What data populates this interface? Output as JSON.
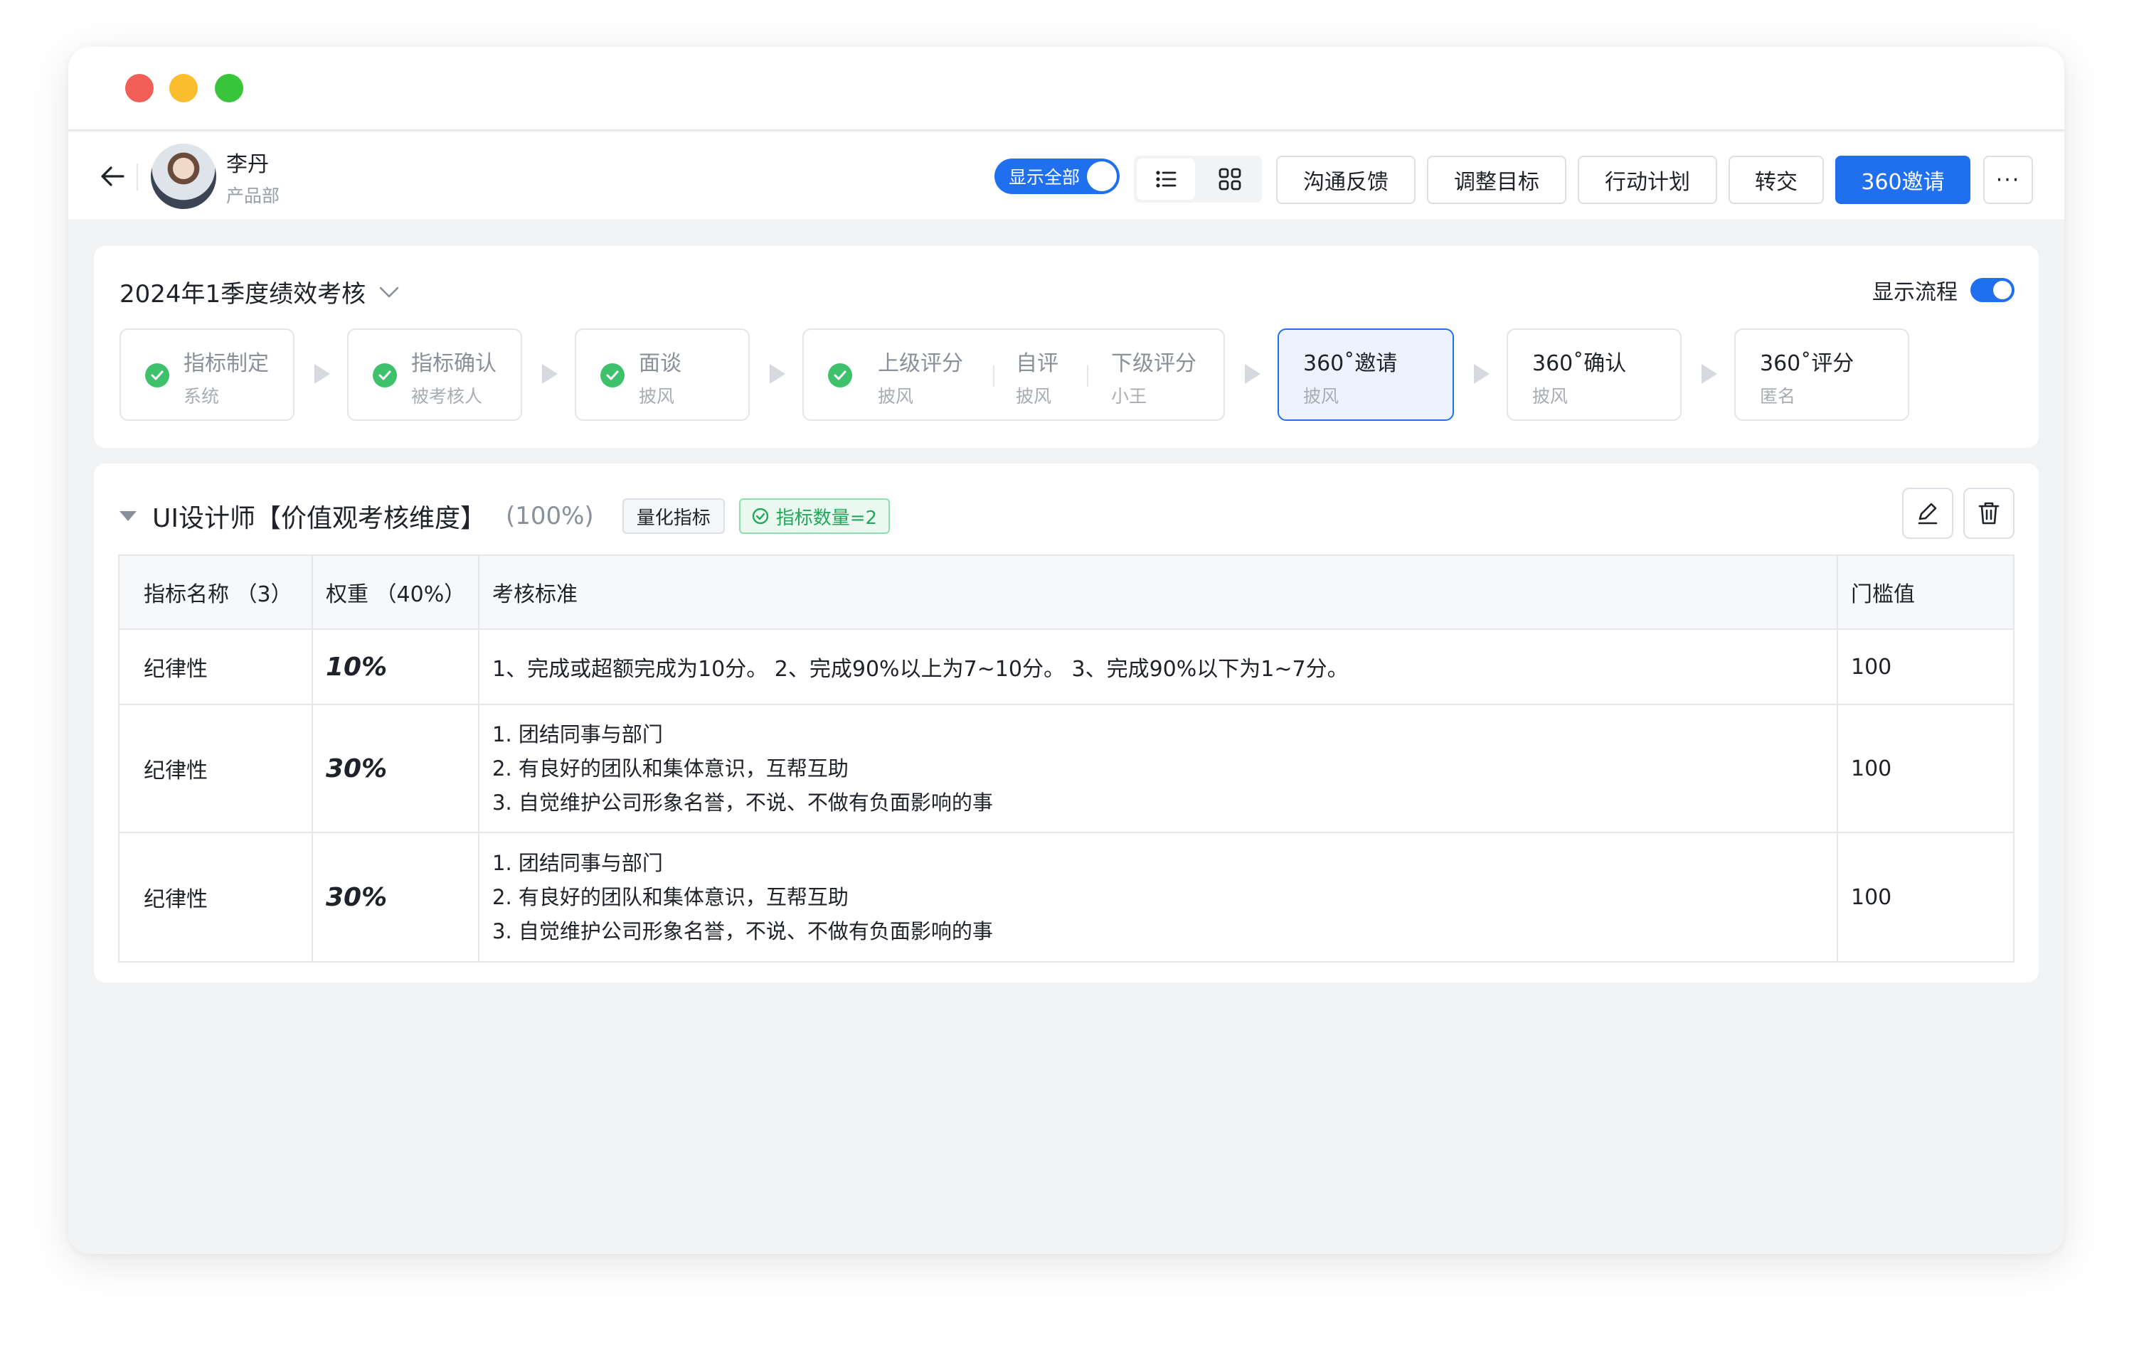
{
  "user": {
    "name": "李丹",
    "dept": "产品部"
  },
  "toolbar": {
    "show_all_label": "显示全部",
    "buttons": [
      "沟通反馈",
      "调整目标",
      "行动计划",
      "转交"
    ],
    "primary": "360邀请",
    "more": "···"
  },
  "flow": {
    "period": "2024年1季度绩效考核",
    "show_flow_label": "显示流程",
    "steps": [
      {
        "title": "指标制定",
        "sub": "系统"
      },
      {
        "title": "指标确认",
        "sub": "被考核人"
      },
      {
        "title": "面谈",
        "sub": "披风"
      },
      {
        "title": "上级评分",
        "sub": "披风"
      },
      {
        "title": "自评",
        "sub": "披风"
      },
      {
        "title": "下级评分",
        "sub": "小王"
      },
      {
        "title": "360˚邀请",
        "sub": "披风"
      },
      {
        "title": "360˚确认",
        "sub": "披风"
      },
      {
        "title": "360˚评分",
        "sub": "匿名"
      }
    ]
  },
  "dimension": {
    "title": "UI设计师【价值观考核维度】",
    "percent": "(100%)",
    "tag_type": "量化指标",
    "tag_count": "指标数量=2"
  },
  "table": {
    "headers": [
      "指标名称 （3）",
      "权重 （40%）",
      "考核标准",
      "门槛值"
    ],
    "rows": [
      {
        "name": "纪律性",
        "weight": "10%",
        "criteria": [
          "1、完成或超额完成为10分。 2、完成90%以上为7~10分。 3、完成90%以下为1~7分。"
        ],
        "threshold": "100"
      },
      {
        "name": "纪律性",
        "weight": "30%",
        "criteria": [
          "1. 团结同事与部门",
          "2. 有良好的团队和集体意识，互帮互助",
          "3. 自觉维护公司形象名誉，不说、不做有负面影响的事"
        ],
        "threshold": "100"
      },
      {
        "name": "纪律性",
        "weight": "30%",
        "criteria": [
          "1. 团结同事与部门",
          "2. 有良好的团队和集体意识，互帮互助",
          "3. 自觉维护公司形象名誉，不说、不做有负面影响的事"
        ],
        "threshold": "100"
      }
    ]
  },
  "colors": {
    "primary": "#1f6fef",
    "success": "#3fc16b"
  }
}
